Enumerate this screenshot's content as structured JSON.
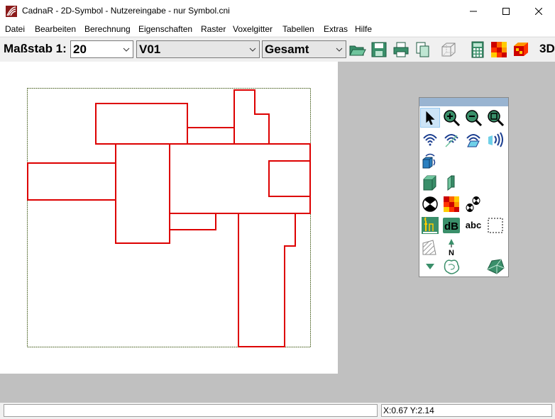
{
  "window": {
    "title": "CadnaR - 2D-Symbol - Nutzereingabe - nur Symbol.cni",
    "controls": [
      "minimize",
      "maximize",
      "close"
    ]
  },
  "menu": [
    "Datei",
    "Bearbeiten",
    "Berechnung",
    "Eigenschaften",
    "Raster",
    "Voxelgitter",
    "Tabellen",
    "Extras",
    "Hilfe"
  ],
  "toolbar": {
    "scale_label": "Maßstab 1:",
    "scale_value": "20",
    "variant_value": "V01",
    "group_value": "Gesamt",
    "view_3d_label": "3D",
    "buttons": [
      "open-icon",
      "save-icon",
      "print-icon",
      "copy-icon",
      "wireframe-cube-icon",
      "calculator-icon",
      "color-grid-icon",
      "color-cube-icon"
    ]
  },
  "palette": {
    "tools": [
      "pointer-icon",
      "zoom-in-icon",
      "zoom-out-icon",
      "zoom-extent-icon",
      "source-omni-icon",
      "source-directional-icon",
      "source-area-icon",
      "source-line-icon",
      "source-cube-icon",
      "block-icon",
      "wall-icon",
      "diffuse-sphere-icon",
      "grid-calc-icon",
      "absorber-icon",
      "receiver-icon",
      "db-label-icon",
      "text-tool-icon",
      "selection-rect-icon",
      "hatch-area-icon",
      "north-arrow-icon",
      "triangle-down-icon",
      "contour-icon",
      "object-3d-icon"
    ],
    "db_label": "dB",
    "text_label": "abc",
    "north_label": "N"
  },
  "status": {
    "message": "",
    "coords": "X:0.67 Y:2.14"
  },
  "colors": {
    "plan_lines": "#dd0000",
    "workspace": "#c0c0c0",
    "palette_title": "#99b4d1"
  }
}
